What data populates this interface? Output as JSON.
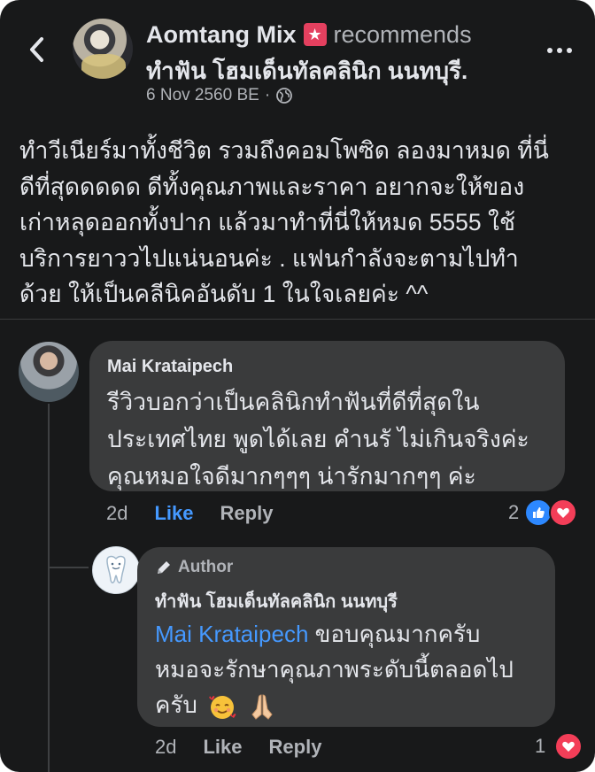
{
  "header": {
    "author": "Aomtang Mix",
    "action": "recommends",
    "page": "ทำฟัน โฮมเด็นทัลคลินิก นนทบุรี.",
    "date": "6 Nov 2560 BE",
    "separator": "·"
  },
  "post": {
    "lines": [
      "ทำวีเนียร์มาทั้งชีวิต รวมถึงคอมโพซิด ลองมาหมด ที่นี่",
      "ดีที่สุดดดดด ดีทั้งคุณภาพและราคา อยากจะให้ของ",
      "เก่าหลุดออกทั้งปาก แล้วมาทำที่นี่ให้หมด 5555 ใช้",
      "บริการยาววไปแน่นอนค่ะ .  แฟนกำลังจะตามไปทำ",
      "ด้วย ให้เป็นคลีนิคอันดับ 1 ในใจเลยค่ะ ^^"
    ]
  },
  "comments": [
    {
      "author": "Mai Krataipech",
      "lines": [
        "รีวิวบอกว่าเป็นคลินิกทำฟันที่ดีที่สุดใน",
        "ประเทศไทย พูดได้เลย คำนรั ไม่เกินจริงค่ะ",
        "คุณหมอใจดีมากๆๆๆ น่ารักมากๆๆ ค่ะ"
      ],
      "time": "2d",
      "like": "Like",
      "reply": "Reply",
      "reactions": "2"
    },
    {
      "author_tag": "Author",
      "author": "ทำฟัน โฮมเด็นทัลคลินิก นนทบุรี",
      "mention": "Mai Krataipech",
      "line1_rest": " ขอบคุณมากครับ",
      "line2": "หมอจะรักษาคุณภาพระดับนี้ตลอดไป",
      "line3": "ครับ",
      "time": "2d",
      "like": "Like",
      "reply": "Reply",
      "reactions": "1"
    }
  ],
  "icons": {
    "back": "chevron-left-icon",
    "more": "more-dots-icon",
    "badge": "top-fan-badge-icon",
    "privacy": "globe-icon",
    "author": "pencil-icon",
    "like_reaction": "thumbs-up-icon",
    "love_reaction": "heart-icon"
  },
  "colors": {
    "background": "#18191a",
    "bubble": "#3a3b3c",
    "text": "#e4e6eb",
    "muted": "#b0b3b8",
    "link": "#4599ff",
    "badge": "#e4405f"
  }
}
